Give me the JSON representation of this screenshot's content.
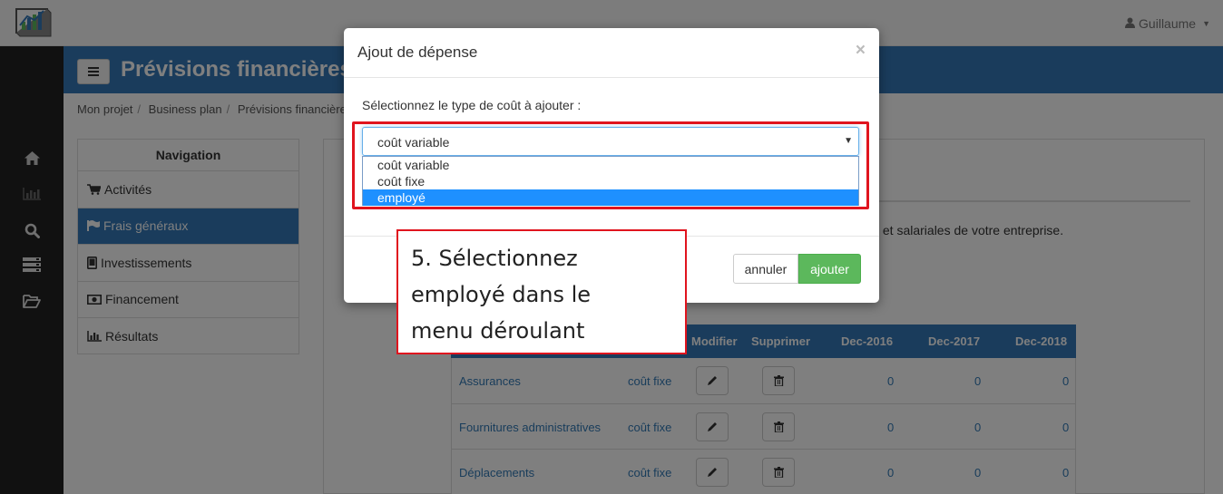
{
  "navbar": {
    "user_name": "Guillaume",
    "user_icon": "user-icon",
    "caret_icon": "caret-down-icon",
    "logo_icon": "chart-logo-icon"
  },
  "rail": {
    "items": [
      {
        "icon": "home-icon"
      },
      {
        "icon": "bar-chart-icon"
      },
      {
        "icon": "search-icon"
      },
      {
        "icon": "server-icon"
      },
      {
        "icon": "folder-open-icon"
      }
    ]
  },
  "header": {
    "title": "Prévisions financières",
    "menu_icon": "hamburger-icon"
  },
  "breadcrumb": [
    "Mon projet",
    "Business plan",
    "Prévisions financière"
  ],
  "nav": {
    "title": "Navigation",
    "items": [
      {
        "label": "Activités",
        "icon": "cart-icon"
      },
      {
        "label": "Frais généraux",
        "icon": "flag-icon",
        "active": true
      },
      {
        "label": "Investissements",
        "icon": "tablet-icon"
      },
      {
        "label": "Financement",
        "icon": "money-icon"
      },
      {
        "label": "Résultats",
        "icon": "bar-chart-icon"
      }
    ]
  },
  "main": {
    "intro": "s et salariales de votre entreprise."
  },
  "table": {
    "headers": {
      "modifier": "Modifier",
      "supprimer": "Supprimer",
      "y2016": "Dec-2016",
      "y2017": "Dec-2017",
      "y2018": "Dec-2018"
    },
    "rows": [
      {
        "name": "Assurances",
        "type": "coût fixe",
        "y2016": "0",
        "y2017": "0",
        "y2018": "0"
      },
      {
        "name": "Fournitures administratives",
        "type": "coût fixe",
        "y2016": "0",
        "y2017": "0",
        "y2018": "0"
      },
      {
        "name": "Déplacements",
        "type": "coût fixe",
        "y2016": "0",
        "y2017": "0",
        "y2018": "0"
      }
    ]
  },
  "modal": {
    "title": "Ajout de dépense",
    "close": "×",
    "label": "Sélectionnez le type de coût à ajouter :",
    "selected_value": "coût variable",
    "options": [
      "coût variable",
      "coût fixe",
      "employé"
    ],
    "highlighted_option": "employé",
    "cancel_label": "annuler",
    "add_label": "ajouter"
  },
  "callout": {
    "line1": "5. Sélectionnez",
    "line2": "employé dans le",
    "line3": "menu déroulant"
  },
  "colors": {
    "primary": "#3479b8",
    "success": "#5cb85c",
    "annotation_red": "#e0141e",
    "option_highlight": "#1e90ff"
  }
}
